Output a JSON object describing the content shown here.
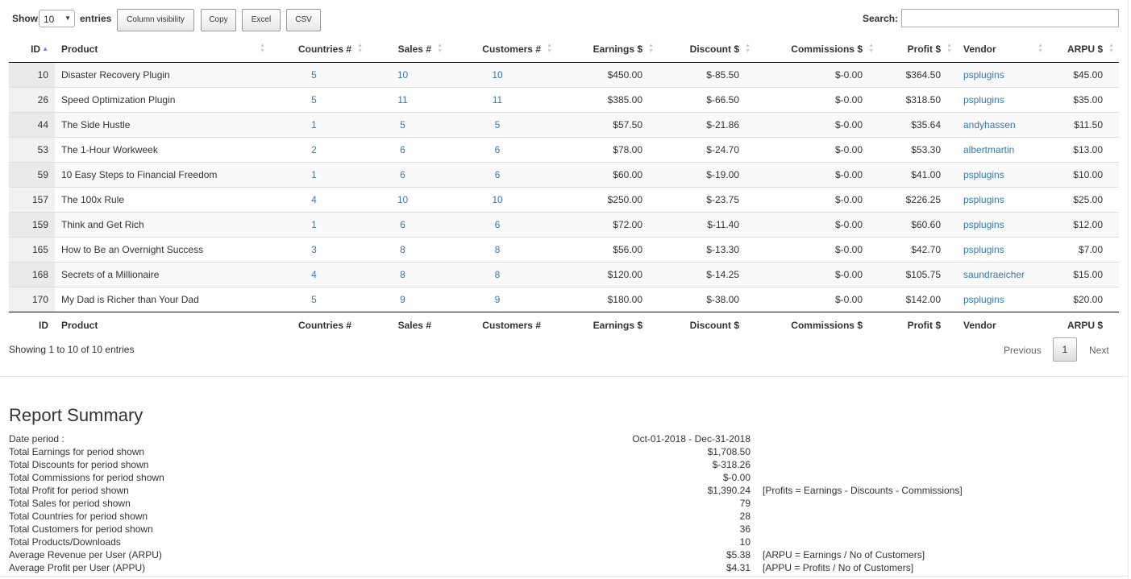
{
  "controls": {
    "show_label": "Show",
    "entries_value": "10",
    "entries_label": "entries",
    "buttons": [
      "Column visibility",
      "Copy",
      "Excel",
      "CSV"
    ],
    "search_label": "Search:",
    "search_value": ""
  },
  "table": {
    "headers": [
      "ID",
      "Product",
      "Countries #",
      "Sales #",
      "Customers #",
      "Earnings $",
      "Discount $",
      "Commissions $",
      "Profit $",
      "Vendor",
      "ARPU $"
    ],
    "rows": [
      [
        "10",
        "Disaster Recovery Plugin",
        "5",
        "10",
        "10",
        "$450.00",
        "$-85.50",
        "$-0.00",
        "$364.50",
        "psplugins",
        "$45.00"
      ],
      [
        "26",
        "Speed Optimization Plugin",
        "5",
        "11",
        "11",
        "$385.00",
        "$-66.50",
        "$-0.00",
        "$318.50",
        "psplugins",
        "$35.00"
      ],
      [
        "44",
        "The Side Hustle",
        "1",
        "5",
        "5",
        "$57.50",
        "$-21.86",
        "$-0.00",
        "$35.64",
        "andyhassen",
        "$11.50"
      ],
      [
        "53",
        "The 1-Hour Workweek",
        "2",
        "6",
        "6",
        "$78.00",
        "$-24.70",
        "$-0.00",
        "$53.30",
        "albertmartin",
        "$13.00"
      ],
      [
        "59",
        "10 Easy Steps to Financial Freedom",
        "1",
        "6",
        "6",
        "$60.00",
        "$-19.00",
        "$-0.00",
        "$41.00",
        "psplugins",
        "$10.00"
      ],
      [
        "157",
        "The 100x Rule",
        "4",
        "10",
        "10",
        "$250.00",
        "$-23.75",
        "$-0.00",
        "$226.25",
        "psplugins",
        "$25.00"
      ],
      [
        "159",
        "Think and Get Rich",
        "1",
        "6",
        "6",
        "$72.00",
        "$-11.40",
        "$-0.00",
        "$60.60",
        "psplugins",
        "$12.00"
      ],
      [
        "165",
        "How to Be an Overnight Success",
        "3",
        "8",
        "8",
        "$56.00",
        "$-13.30",
        "$-0.00",
        "$42.70",
        "psplugins",
        "$7.00"
      ],
      [
        "168",
        "Secrets of a Millionaire",
        "4",
        "8",
        "8",
        "$120.00",
        "$-14.25",
        "$-0.00",
        "$105.75",
        "saundraeicher",
        "$15.00"
      ],
      [
        "170",
        "My Dad is Richer than Your Dad",
        "5",
        "9",
        "9",
        "$180.00",
        "$-38.00",
        "$-0.00",
        "$142.00",
        "psplugins",
        "$20.00"
      ]
    ]
  },
  "footer": {
    "info": "Showing 1 to 10 of 10 entries",
    "previous": "Previous",
    "page": "1",
    "next": "Next"
  },
  "summary": {
    "title": "Report Summary",
    "rows": [
      {
        "label": "Date period :",
        "value": "Oct-01-2018 - Dec-31-2018",
        "note": ""
      },
      {
        "label": "Total Earnings for period shown",
        "value": "$1,708.50",
        "note": ""
      },
      {
        "label": "Total Discounts for period shown",
        "value": "$-318.26",
        "note": ""
      },
      {
        "label": "Total Commissions for period shown",
        "value": "$-0.00",
        "note": ""
      },
      {
        "label": "Total Profit for period shown",
        "value": "$1,390.24",
        "note": "[Profits = Earnings - Discounts - Commissions]"
      },
      {
        "label": "Total Sales for period shown",
        "value": "79",
        "note": ""
      },
      {
        "label": "Total Countries for period shown",
        "value": "28",
        "note": ""
      },
      {
        "label": "Total Customers for period shown",
        "value": "36",
        "note": ""
      },
      {
        "label": "Total Products/Downloads",
        "value": "10",
        "note": ""
      },
      {
        "label": "Average Revenue per User (ARPU)",
        "value": "$5.38",
        "note": "[ARPU = Earnings / No of Customers]"
      },
      {
        "label": "Average Profit per User (APPU)",
        "value": "$4.31",
        "note": "[APPU = Profits / No of Customers]"
      }
    ]
  },
  "colors": {
    "link": "#337ab7",
    "sort_active": "#6d7fcc"
  }
}
